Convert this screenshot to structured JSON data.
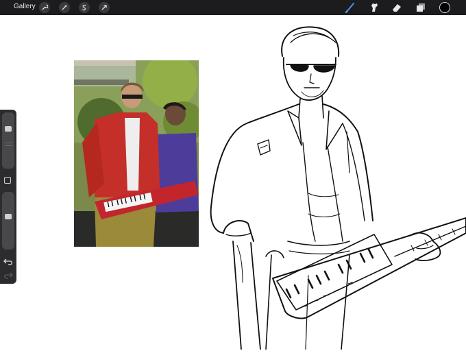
{
  "toolbar": {
    "gallery_label": "Gallery",
    "left_tools": [
      "wrench-icon",
      "magic-wand-icon",
      "selection-icon",
      "transform-arrow-icon"
    ],
    "right_tools": [
      "brush-icon",
      "smudge-icon",
      "eraser-icon",
      "layers-icon"
    ],
    "brush_active_color": "#4a90e2",
    "current_color": "#000000"
  },
  "sidebar": {
    "sliders": [
      "brush-size-slider",
      "opacity-slider"
    ],
    "buttons": [
      "modifier-button",
      "undo-button",
      "redo-button"
    ]
  },
  "canvas": {
    "reference": "reference-photo",
    "drawing": "line-sketch"
  }
}
